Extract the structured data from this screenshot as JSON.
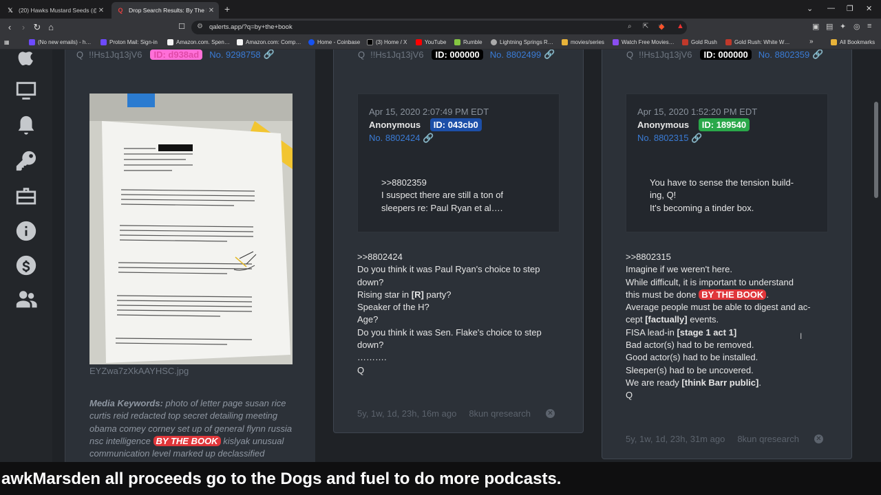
{
  "browser": {
    "tabs": [
      {
        "label": "(20) Hawks Mustard Seeds (@hawk…",
        "icon": "x-logo-icon"
      },
      {
        "label": "Drop Search Results: By The Bo…",
        "icon": "q-logo-icon"
      }
    ],
    "url": "qalerts.app/?q=by+the+book",
    "bookmarks": [
      {
        "label": "(No new emails) - h…",
        "color": "#6d4aff"
      },
      {
        "label": "Proton Mail: Sign-in",
        "color": "#6d4aff"
      },
      {
        "label": "Amazon.com. Spen…",
        "color": "#f4f4f4"
      },
      {
        "label": "Amazon.com: Comp…",
        "color": "#f4f4f4"
      },
      {
        "label": "Home - Coinbase",
        "color": "#1652f0"
      },
      {
        "label": "(3) Home / X",
        "color": "#000000"
      },
      {
        "label": "YouTube",
        "color": "#ff0000"
      },
      {
        "label": "Rumble",
        "color": "#85c742"
      },
      {
        "label": "Lightning Springs R…",
        "color": "#aaaaaa"
      },
      {
        "label": "movies/series",
        "color": "#e8b339"
      },
      {
        "label": "Watch Free Movies…",
        "color": "#8a4df0"
      },
      {
        "label": "Gold Rush",
        "color": "#c0392b"
      },
      {
        "label": "Gold Rush: White W…",
        "color": "#c0392b"
      }
    ],
    "more_bookmarks": "»",
    "all_bookmarks": "All Bookmarks"
  },
  "sidebar": {
    "icons": [
      "apple-icon",
      "monitor-icon",
      "bell-icon",
      "key-icon",
      "toolbox-icon",
      "info-icon",
      "dollar-icon",
      "users-icon"
    ]
  },
  "posts": [
    {
      "top_q": "Q",
      "top_trip": "!!Hs1Jq13jV6",
      "top_id": "ID: d938ad",
      "top_id_color": "#ff6fd8",
      "top_no": "No. 9298758",
      "image_name": "EYZwa7zXkAAYHSC.jpg",
      "keywords_label": "Media Keywords:",
      "keywords_text": "photo of letter page susan rice curtis reid redacted top secret detailing meeting obama comey corney set up of general flynn russia nsc intelligence",
      "keywords_pill": "BY THE BOOK",
      "keywords_tail": "kislyak unusual communication level marked up declassified paragraph"
    },
    {
      "top_q": "Q",
      "top_trip": "!!Hs1Jq13jV6",
      "top_id": "ID: 000000",
      "top_id_color": "#000000",
      "top_no": "No. 8802499",
      "quote": {
        "date": "Apr 15, 2020 2:07:49 PM EDT",
        "name": "Anonymous",
        "id": "ID: 043cb0",
        "id_color": "#1c4fa8",
        "no": "No. 8802424",
        "lines": [
          ">>8802359",
          "I suspect there are still a ton of",
          "sleepers re: Paul Ryan et al…."
        ]
      },
      "body_lines": [
        ">>8802424",
        "Do you think it was Paul Ryan's choice to step",
        "down?",
        "Rising star in [R] party?",
        "Speaker of the H?",
        "Age?",
        "Do you think it was Sen. Flake's choice to step",
        "down?",
        "……….",
        "Q"
      ],
      "footer_age": "5y, 1w, 1d, 23h, 16m ago",
      "footer_source": "8kun qresearch"
    },
    {
      "top_q": "Q",
      "top_trip": "!!Hs1Jq13jV6",
      "top_id": "ID: 000000",
      "top_id_color": "#000000",
      "top_no": "No. 8802359",
      "quote": {
        "date": "Apr 15, 2020 1:52:20 PM EDT",
        "name": "Anonymous",
        "id": "ID: 189540",
        "id_color": "#2aa84a",
        "no": "No. 8802315",
        "lines": [
          "You have to sense the tension build-",
          "ing, Q!",
          "It's becoming a tinder box."
        ]
      },
      "body": {
        "l1": ">>8802315",
        "l2": "Imagine if we weren't here.",
        "l3": "While difficult, it is important to understand",
        "l4a": "this must be done",
        "l4_pill": "BY THE BOOK",
        "l4b": ".",
        "l5": "Average people must be able to digest and ac-",
        "l6a": "cept",
        "l6b": "[factually]",
        "l6c": "events.",
        "l7a": "FISA lead-in",
        "l7b": "[stage 1 act 1]",
        "l8": "Bad actor(s) had to be removed.",
        "l9": "Good actor(s) had to be installed.",
        "l10": "Sleeper(s) had to be uncovered.",
        "l11a": "We are ready",
        "l11b": "[think Barr public]",
        "l11c": ".",
        "l12": "Q"
      },
      "footer_age": "5y, 1w, 1d, 23h, 31m ago",
      "footer_source": "8kun qresearch"
    }
  ],
  "ticker": "awkMarsden all proceeds go to the Dogs and fuel to do more podcasts."
}
